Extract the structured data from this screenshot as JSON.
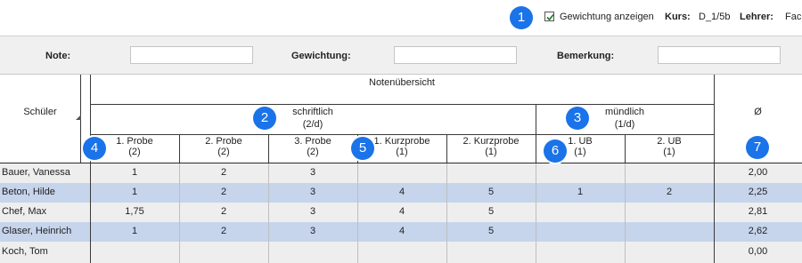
{
  "topbar": {
    "checkbox_label": "Gewichtung anzeigen",
    "checkbox_checked": true,
    "kurs_label": "Kurs:",
    "kurs_value": "D_1/5b",
    "lehrer_label": "Lehrer:",
    "lehrer_value": "Fach"
  },
  "form": {
    "note_label": "Note:",
    "gewichtung_label": "Gewichtung:",
    "bemerkung_label": "Bemerkung:"
  },
  "table": {
    "student_header": "Schüler",
    "overview_header": "Notenübersicht",
    "written": {
      "title": "schriftlich",
      "weight": "(2/d)"
    },
    "oral": {
      "title": "mündlich",
      "weight": "(1/d)"
    },
    "average_header": "Ø",
    "columns": [
      {
        "name": "1. Probe",
        "weight": "(2)"
      },
      {
        "name": "2. Probe",
        "weight": "(2)"
      },
      {
        "name": "3. Probe",
        "weight": "(2)"
      },
      {
        "name": "1. Kurzprobe",
        "weight": "(1)"
      },
      {
        "name": "2. Kurzprobe",
        "weight": "(1)"
      },
      {
        "name": "1. UB",
        "weight": "(1)"
      },
      {
        "name": "2. UB",
        "weight": "(1)"
      }
    ],
    "rows": [
      {
        "name": "Bauer, Vanessa",
        "grades": [
          "1",
          "2",
          "3",
          "",
          "",
          "",
          ""
        ],
        "avg": "2,00"
      },
      {
        "name": "Beton, Hilde",
        "grades": [
          "1",
          "2",
          "3",
          "4",
          "5",
          "1",
          "2"
        ],
        "avg": "2,25"
      },
      {
        "name": "Chef, Max",
        "grades": [
          "1,75",
          "2",
          "3",
          "4",
          "5",
          "",
          ""
        ],
        "avg": "2,81"
      },
      {
        "name": "Glaser, Heinrich",
        "grades": [
          "1",
          "2",
          "3",
          "4",
          "5",
          "",
          ""
        ],
        "avg": "2,62"
      },
      {
        "name": "Koch, Tom",
        "grades": [
          "",
          "",
          "",
          "",
          "",
          "",
          ""
        ],
        "avg": "0,00"
      }
    ]
  },
  "callouts": [
    "1",
    "2",
    "3",
    "4",
    "5",
    "6",
    "7"
  ],
  "colors": {
    "badge": "#1a73e8",
    "row_highlight": "#c6d4ec",
    "row_normal": "#eeeeee"
  }
}
